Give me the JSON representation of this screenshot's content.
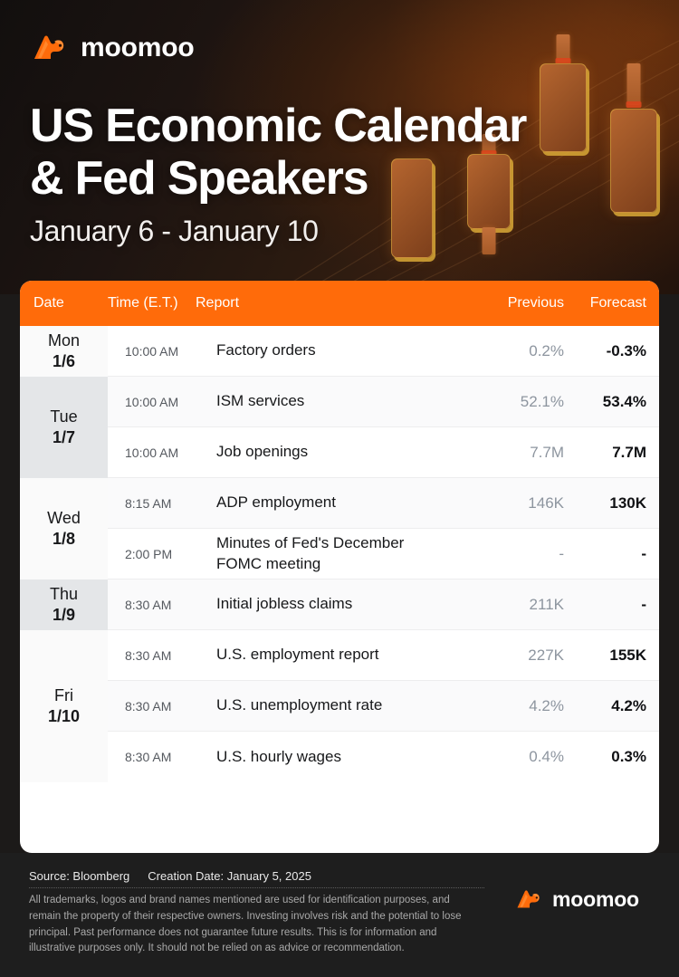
{
  "brand": {
    "name": "moomoo",
    "logo_icon": "bull-head-icon",
    "accent": "#ff6b0a"
  },
  "hero": {
    "title_line1": "US Economic Calendar",
    "title_line2": "& Fed Speakers",
    "date_range": "January 6 - January 10",
    "background": "#1c1a19"
  },
  "table": {
    "headers": {
      "date": "Date",
      "time": "Time (E.T.)",
      "report": "Report",
      "previous": "Previous",
      "forecast": "Forecast"
    },
    "groups": [
      {
        "dow": "Mon",
        "dnum": "1/6",
        "rows": [
          {
            "time": "10:00 AM",
            "report": "Factory orders",
            "previous": "0.2%",
            "forecast": "-0.3%"
          }
        ]
      },
      {
        "dow": "Tue",
        "dnum": "1/7",
        "rows": [
          {
            "time": "10:00 AM",
            "report": "ISM services",
            "previous": "52.1%",
            "forecast": "53.4%"
          },
          {
            "time": "10:00 AM",
            "report": "Job openings",
            "previous": "7.7M",
            "forecast": "7.7M"
          }
        ]
      },
      {
        "dow": "Wed",
        "dnum": "1/8",
        "rows": [
          {
            "time": "8:15 AM",
            "report": "ADP employment",
            "previous": "146K",
            "forecast": "130K"
          },
          {
            "time": "2:00 PM",
            "report": "Minutes of Fed's December FOMC meeting",
            "previous": "-",
            "forecast": "-"
          }
        ]
      },
      {
        "dow": "Thu",
        "dnum": "1/9",
        "rows": [
          {
            "time": "8:30 AM",
            "report": "Initial jobless claims",
            "previous": "211K",
            "forecast": "-"
          }
        ]
      },
      {
        "dow": "Fri",
        "dnum": "1/10",
        "rows": [
          {
            "time": "8:30 AM",
            "report": "U.S. employment report",
            "previous": "227K",
            "forecast": "155K"
          },
          {
            "time": "8:30 AM",
            "report": "U.S. unemployment rate",
            "previous": "4.2%",
            "forecast": "4.2%"
          },
          {
            "time": "8:30 AM",
            "report": "U.S. hourly wages",
            "previous": "0.4%",
            "forecast": "0.3%"
          }
        ]
      }
    ]
  },
  "footer": {
    "source": "Source: Bloomberg",
    "creation_date": "Creation Date: January 5, 2025",
    "disclaimer": "All trademarks, logos and brand names mentioned are used for identification purposes, and remain the property of their respective owners. Investing involves risk and the potential to lose principal. Past performance does not guarantee future results. This is for information and illustrative purposes only. It should not be relied on as advice or recommendation.",
    "logo_name": "moomoo"
  }
}
